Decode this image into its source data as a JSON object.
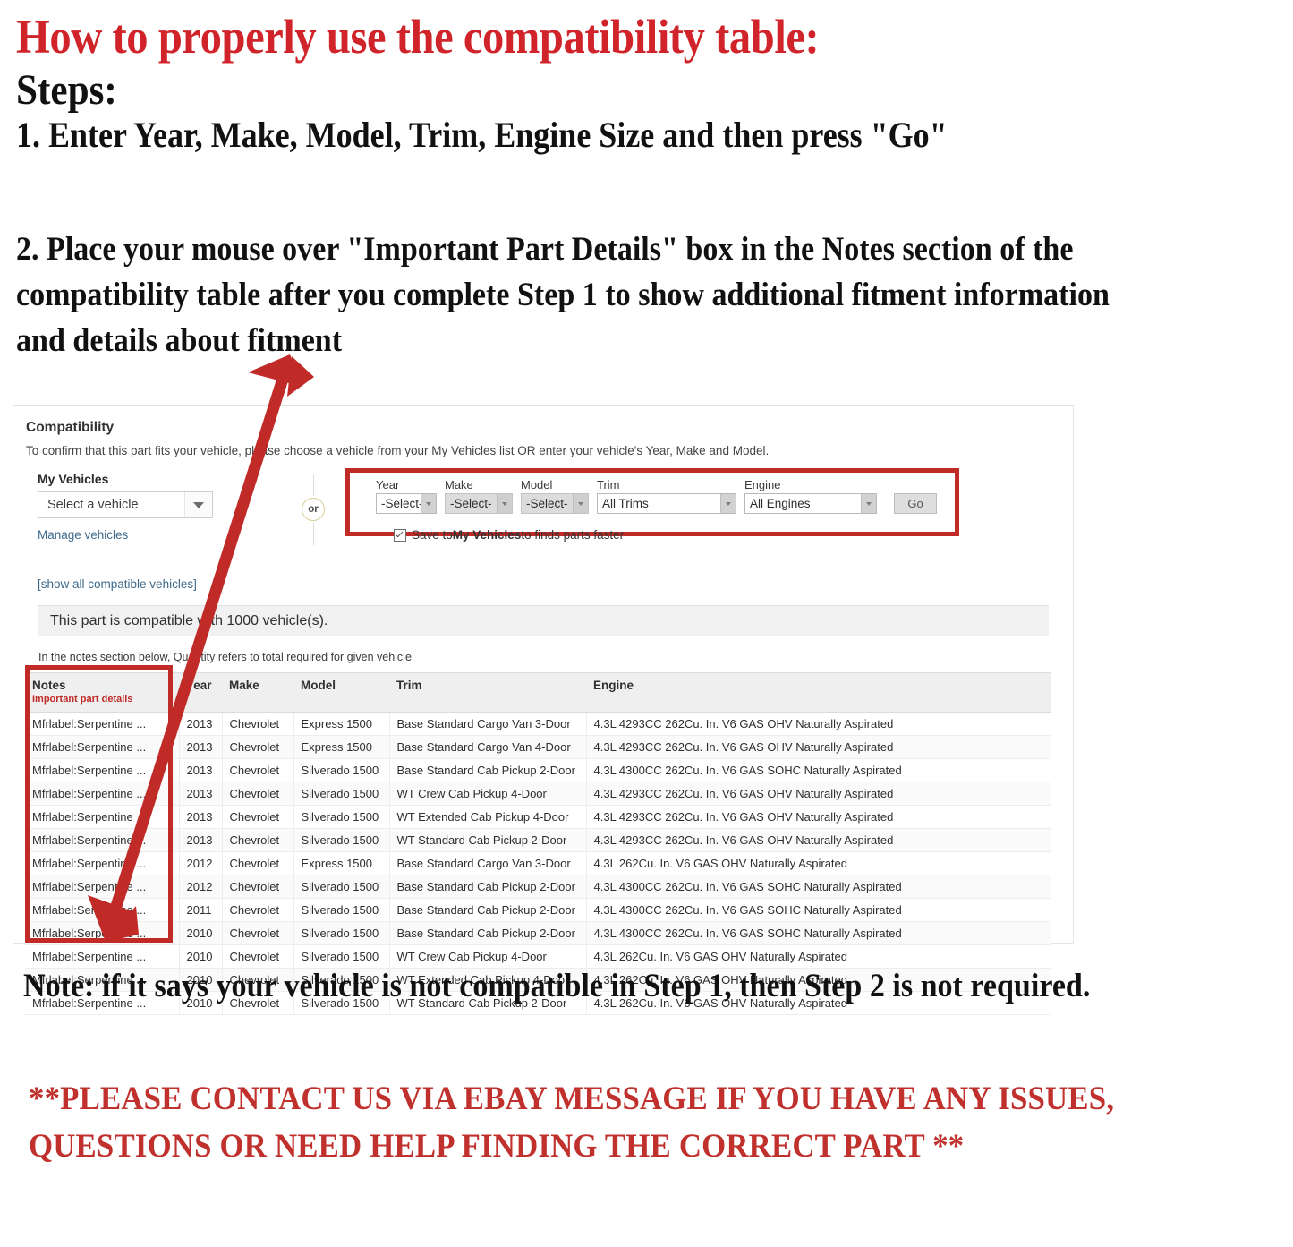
{
  "instructions": {
    "headline": "How to properly use the compatibility table:",
    "steps_label": "Steps:",
    "step1": "1. Enter Year, Make, Model, Trim, Engine Size and then press \"Go\"",
    "step2": "2. Place your mouse over \"Important Part Details\" box in the Notes section of the compatibility table after you complete Step 1 to show additional fitment information and details about fitment",
    "note": "Note: if it says your vehicle is not compatible in Step 1, then Step 2 is not required.",
    "contact": "**PLEASE CONTACT US VIA EBAY MESSAGE IF YOU HAVE ANY ISSUES, QUESTIONS OR NEED HELP FINDING THE CORRECT PART **"
  },
  "colors": {
    "annotation_red": "#c02a27",
    "headline_red": "#d0242a",
    "link_blue": "#3d6a8a",
    "or_ring": "#d8cf9a"
  },
  "panel": {
    "title": "Compatibility",
    "subtitle": "To confirm that this part fits your vehicle, please choose a vehicle from your My Vehicles list OR enter your vehicle's Year, Make and Model.",
    "my_vehicles": {
      "label": "My Vehicles",
      "select_value": "Select a vehicle",
      "manage_link": "Manage vehicles"
    },
    "or_label": "or",
    "finder": {
      "fields": [
        {
          "label": "Year",
          "value": "-Select-",
          "dim": false
        },
        {
          "label": "Make",
          "value": "-Select-",
          "dim": true
        },
        {
          "label": "Model",
          "value": "-Select-",
          "dim": true
        },
        {
          "label": "Trim",
          "value": "All Trims",
          "dim": false
        },
        {
          "label": "Engine",
          "value": "All Engines",
          "dim": false
        }
      ],
      "go_label": "Go",
      "save_prefix": "Save to ",
      "save_bold": "My Vehicles",
      "save_suffix": " to finds parts faster"
    },
    "show_all_link": "[show all compatible vehicles]",
    "compat_banner": "This part is compatible with 1000 vehicle(s).",
    "qty_note": "In the notes section below, Quantity refers to total required for given vehicle",
    "table": {
      "columns": [
        "Notes",
        "Year",
        "Make",
        "Model",
        "Trim",
        "Engine"
      ],
      "notes_sub": "Important part details",
      "rows": [
        [
          "Mfrlabel:Serpentine ...",
          "2013",
          "Chevrolet",
          "Express 1500",
          "Base Standard Cargo Van 3-Door",
          "4.3L 4293CC 262Cu. In. V6 GAS OHV Naturally Aspirated"
        ],
        [
          "Mfrlabel:Serpentine ...",
          "2013",
          "Chevrolet",
          "Express 1500",
          "Base Standard Cargo Van 4-Door",
          "4.3L 4293CC 262Cu. In. V6 GAS OHV Naturally Aspirated"
        ],
        [
          "Mfrlabel:Serpentine ...",
          "2013",
          "Chevrolet",
          "Silverado 1500",
          "Base Standard Cab Pickup 2-Door",
          "4.3L 4300CC 262Cu. In. V6 GAS SOHC Naturally Aspirated"
        ],
        [
          "Mfrlabel:Serpentine ...",
          "2013",
          "Chevrolet",
          "Silverado 1500",
          "WT Crew Cab Pickup 4-Door",
          "4.3L 4293CC 262Cu. In. V6 GAS OHV Naturally Aspirated"
        ],
        [
          "Mfrlabel:Serpentine ...",
          "2013",
          "Chevrolet",
          "Silverado 1500",
          "WT Extended Cab Pickup 4-Door",
          "4.3L 4293CC 262Cu. In. V6 GAS OHV Naturally Aspirated"
        ],
        [
          "Mfrlabel:Serpentine ...",
          "2013",
          "Chevrolet",
          "Silverado 1500",
          "WT Standard Cab Pickup 2-Door",
          "4.3L 4293CC 262Cu. In. V6 GAS OHV Naturally Aspirated"
        ],
        [
          "Mfrlabel:Serpentine ...",
          "2012",
          "Chevrolet",
          "Express 1500",
          "Base Standard Cargo Van 3-Door",
          "4.3L 262Cu. In. V6 GAS OHV Naturally Aspirated"
        ],
        [
          "Mfrlabel:Serpentine ...",
          "2012",
          "Chevrolet",
          "Silverado 1500",
          "Base Standard Cab Pickup 2-Door",
          "4.3L 4300CC 262Cu. In. V6 GAS SOHC Naturally Aspirated"
        ],
        [
          "Mfrlabel:Serpentine ...",
          "2011",
          "Chevrolet",
          "Silverado 1500",
          "Base Standard Cab Pickup 2-Door",
          "4.3L 4300CC 262Cu. In. V6 GAS SOHC Naturally Aspirated"
        ],
        [
          "Mfrlabel:Serpentine ...",
          "2010",
          "Chevrolet",
          "Silverado 1500",
          "Base Standard Cab Pickup 2-Door",
          "4.3L 4300CC 262Cu. In. V6 GAS SOHC Naturally Aspirated"
        ],
        [
          "Mfrlabel:Serpentine ...",
          "2010",
          "Chevrolet",
          "Silverado 1500",
          "WT Crew Cab Pickup 4-Door",
          "4.3L 262Cu. In. V6 GAS OHV Naturally Aspirated"
        ],
        [
          "Mfrlabel:Serpentine ...",
          "2010",
          "Chevrolet",
          "Silverado 1500",
          "WT Extended Cab Pickup 4-Door",
          "4.3L 262Cu. In. V6 GAS OHV Naturally Aspirated"
        ],
        [
          "Mfrlabel:Serpentine ...",
          "2010",
          "Chevrolet",
          "Silverado 1500",
          "WT Standard Cab Pickup 2-Door",
          "4.3L 262Cu. In. V6 GAS OHV Naturally Aspirated"
        ]
      ]
    }
  }
}
